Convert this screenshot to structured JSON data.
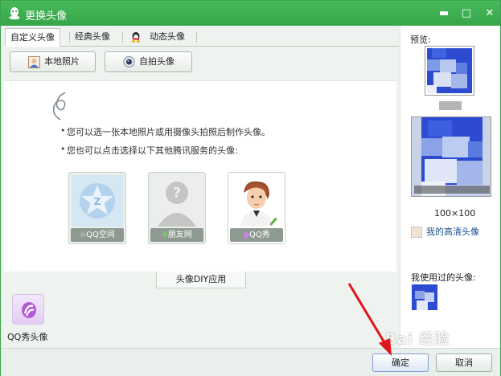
{
  "window": {
    "title": "更换头像",
    "minimize_label": "▬",
    "maximize_label": "□",
    "close_label": "✕"
  },
  "tabs": [
    {
      "label": "自定义头像",
      "active": true
    },
    {
      "label": "经典头像",
      "active": false
    },
    {
      "label": "动态头像",
      "active": false
    }
  ],
  "toolbar": {
    "local_photo_label": "本地照片",
    "selfie_label": "自拍头像"
  },
  "main": {
    "hint_1": "您可以选一张本地照片或用摄像头拍照后制作头像。",
    "hint_2": "您也可以点击选择以下其他腾讯服务的头像:",
    "services": [
      {
        "label": "QQ空间",
        "icon": "qzone-star-icon"
      },
      {
        "label": "朋友网",
        "icon": "pengyou-question-icon"
      },
      {
        "label": "QQ秀",
        "icon": "qqshow-avatar-icon"
      }
    ],
    "diy_tab_label": "头像DIY应用",
    "qqshow_app_label": "QQ秀头像"
  },
  "sidebar": {
    "preview_label": "预览:",
    "size_label": "100×100",
    "hd_avatar_label": "我的高清头像",
    "used_label": "我使用过的头像:"
  },
  "footer": {
    "ok_label": "确定",
    "cancel_label": "取消"
  },
  "watermark": "Bai 经验",
  "colors": {
    "titlebar": "#3fae52",
    "accent_blue": "#2f4ed2",
    "arrow_red": "#e0141b"
  }
}
